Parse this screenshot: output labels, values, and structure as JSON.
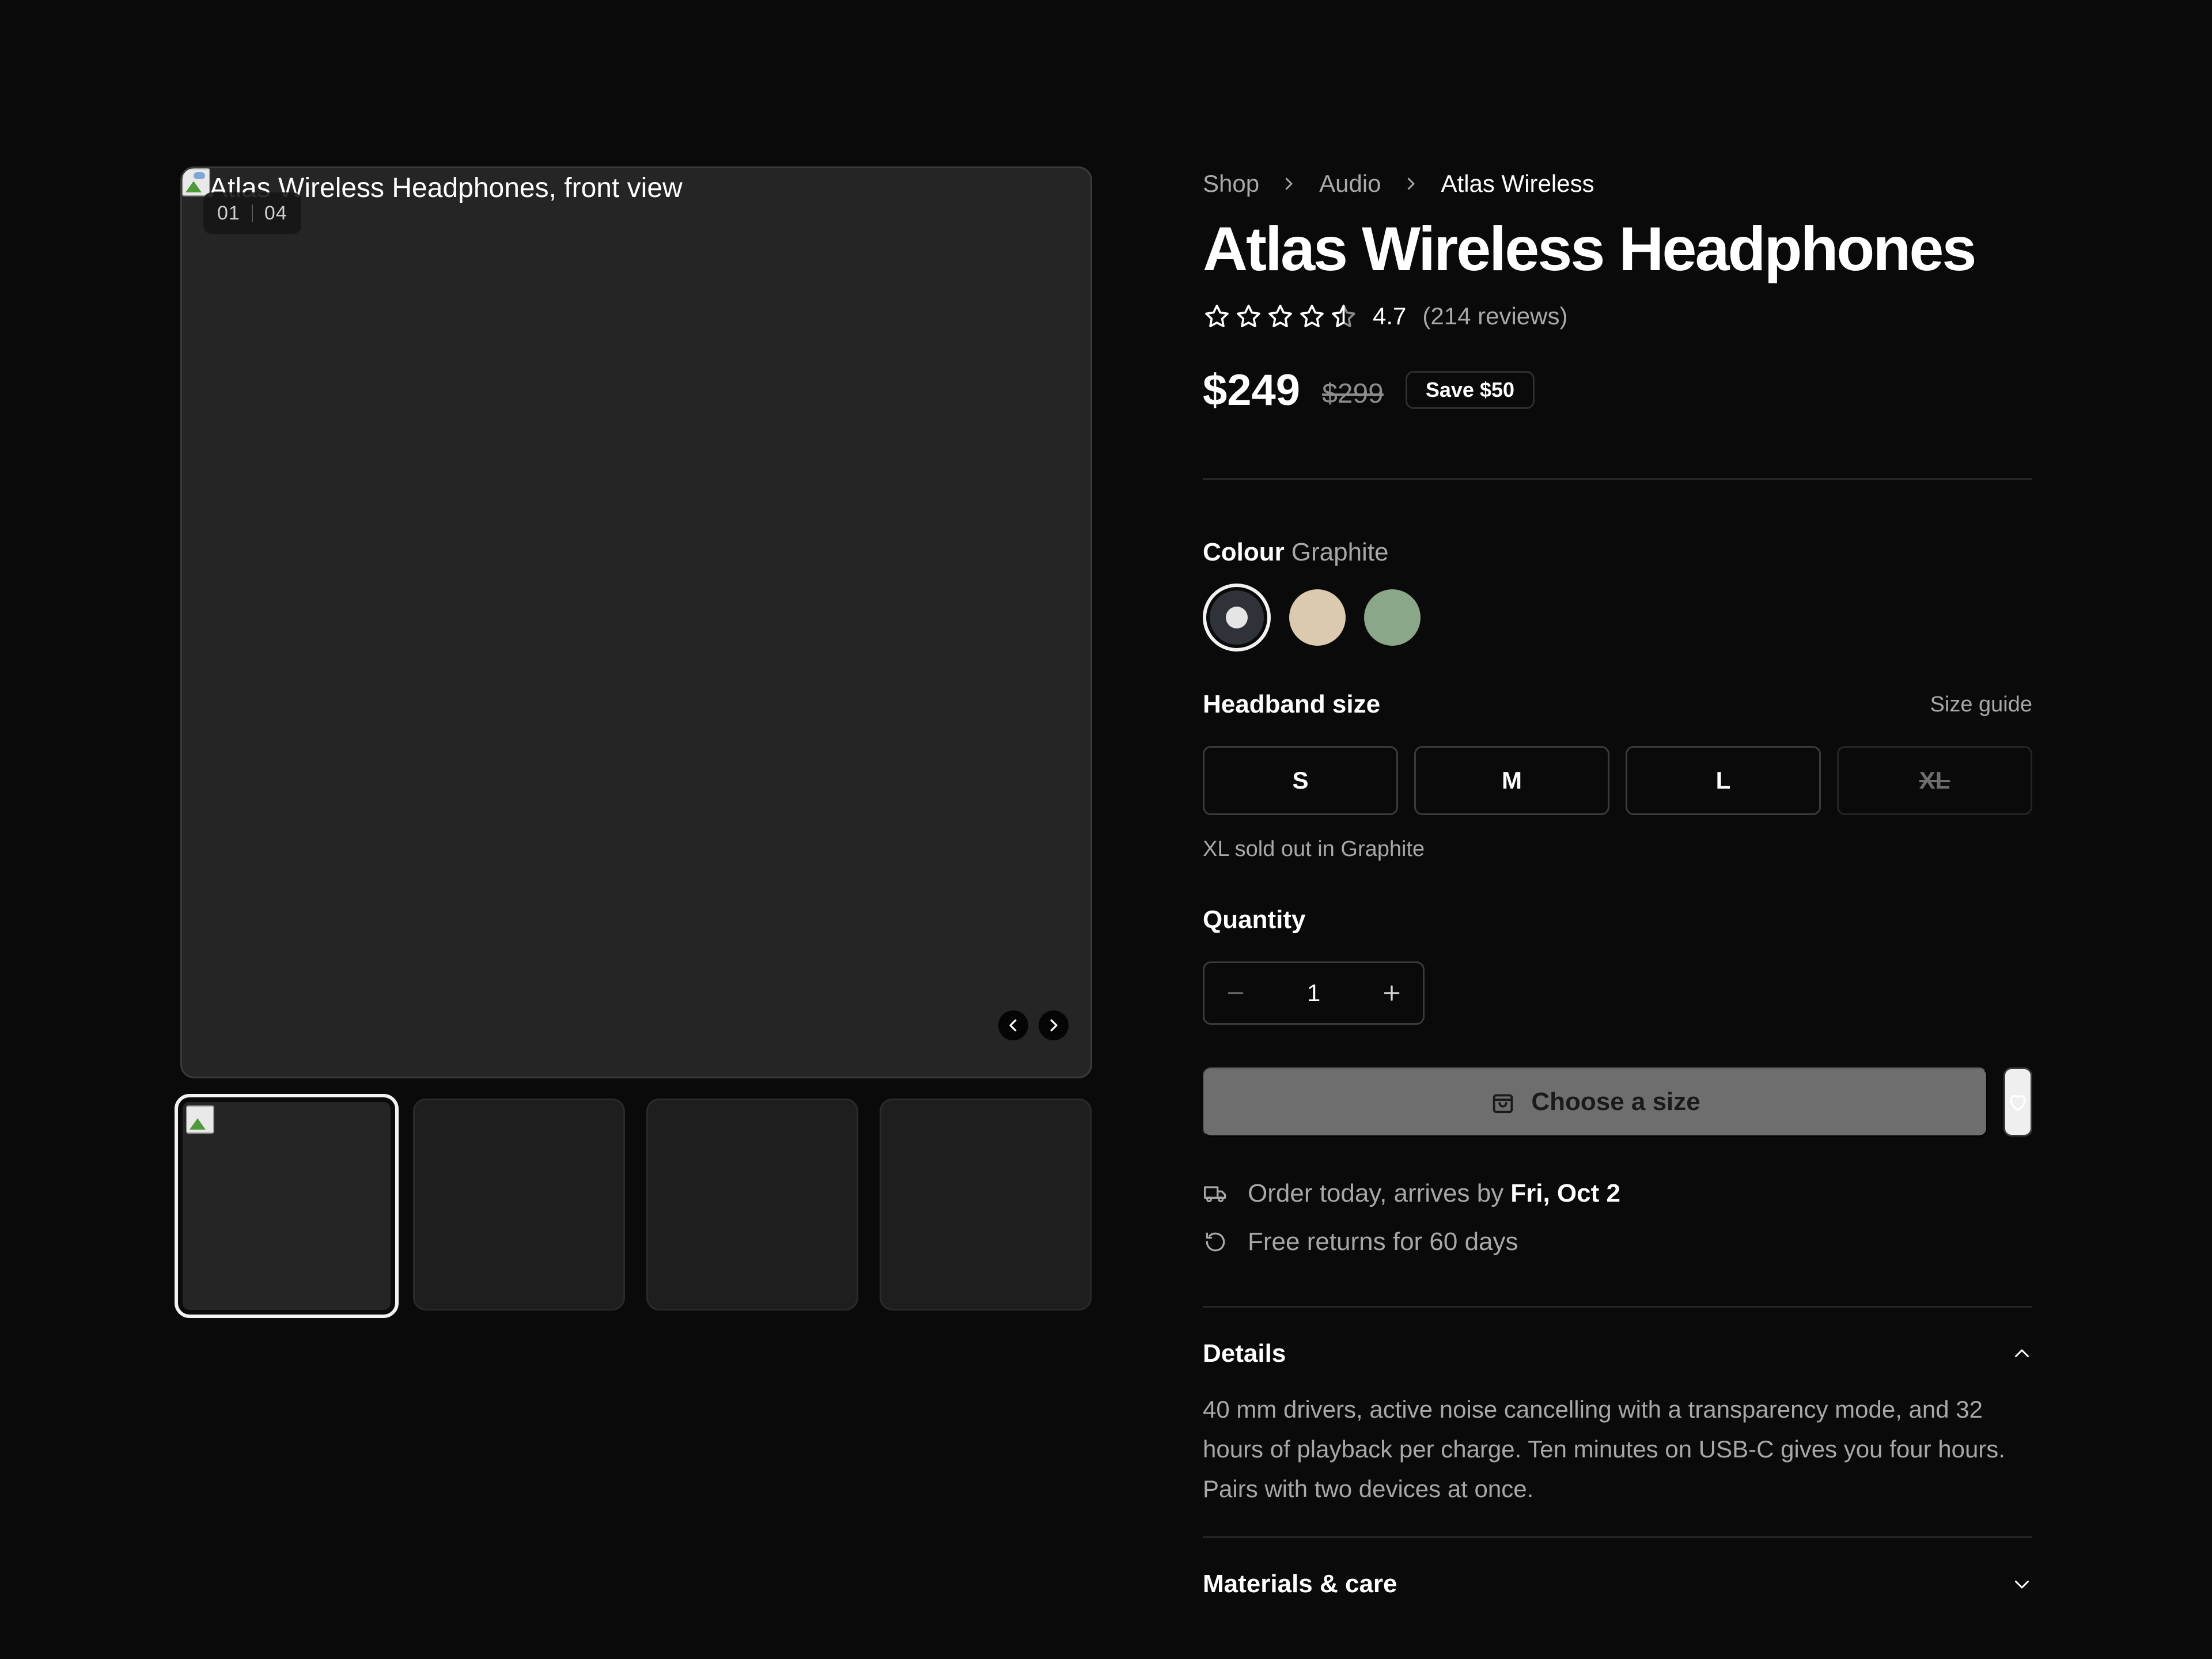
{
  "gallery": {
    "main_alt": "Atlas Wireless Headphones, front view",
    "counter_current": "01",
    "counter_total": "04"
  },
  "breadcrumb": [
    "Shop",
    "Audio",
    "Atlas Wireless"
  ],
  "product": {
    "title": "Atlas Wireless Headphones",
    "rating": "4.7",
    "rating_value": 4.7,
    "reviews": "(214 reviews)",
    "price": "$249",
    "old_price": "$299",
    "save_badge": "Save $50"
  },
  "colour": {
    "label": "Colour",
    "selected": "Graphite",
    "swatches": [
      {
        "name": "Graphite",
        "hex": "#2f3238",
        "selected": true
      },
      {
        "name": "Sand",
        "hex": "#dccab0"
      },
      {
        "name": "Sage",
        "hex": "#8aa889"
      }
    ]
  },
  "size": {
    "label": "Headband size",
    "guide": "Size guide",
    "options": [
      {
        "label": "S",
        "available": true
      },
      {
        "label": "M",
        "available": true
      },
      {
        "label": "L",
        "available": true
      },
      {
        "label": "XL",
        "available": false
      }
    ],
    "note": "XL sold out in Graphite"
  },
  "quantity": {
    "label": "Quantity",
    "value": "1"
  },
  "cta": {
    "label": "Choose a size",
    "icon": "shopping-bag-icon"
  },
  "perks": {
    "delivery_text": "Order today, arrives by",
    "delivery_date": "Fri, Oct 2",
    "returns_text": "Free returns for 60 days"
  },
  "accordion": {
    "details_title": "Details",
    "details_body": "40 mm drivers, active noise cancelling with a transparency mode, and 32 hours of playback per charge. Ten minutes on USB-C gives you four hours. Pairs with two devices at once.",
    "materials_title": "Materials & care"
  },
  "colors": {
    "background": "#0a0a0a",
    "surface": "#252525",
    "muted_text": "#a8a8a8",
    "cta_disabled": "#6e6e6e"
  }
}
